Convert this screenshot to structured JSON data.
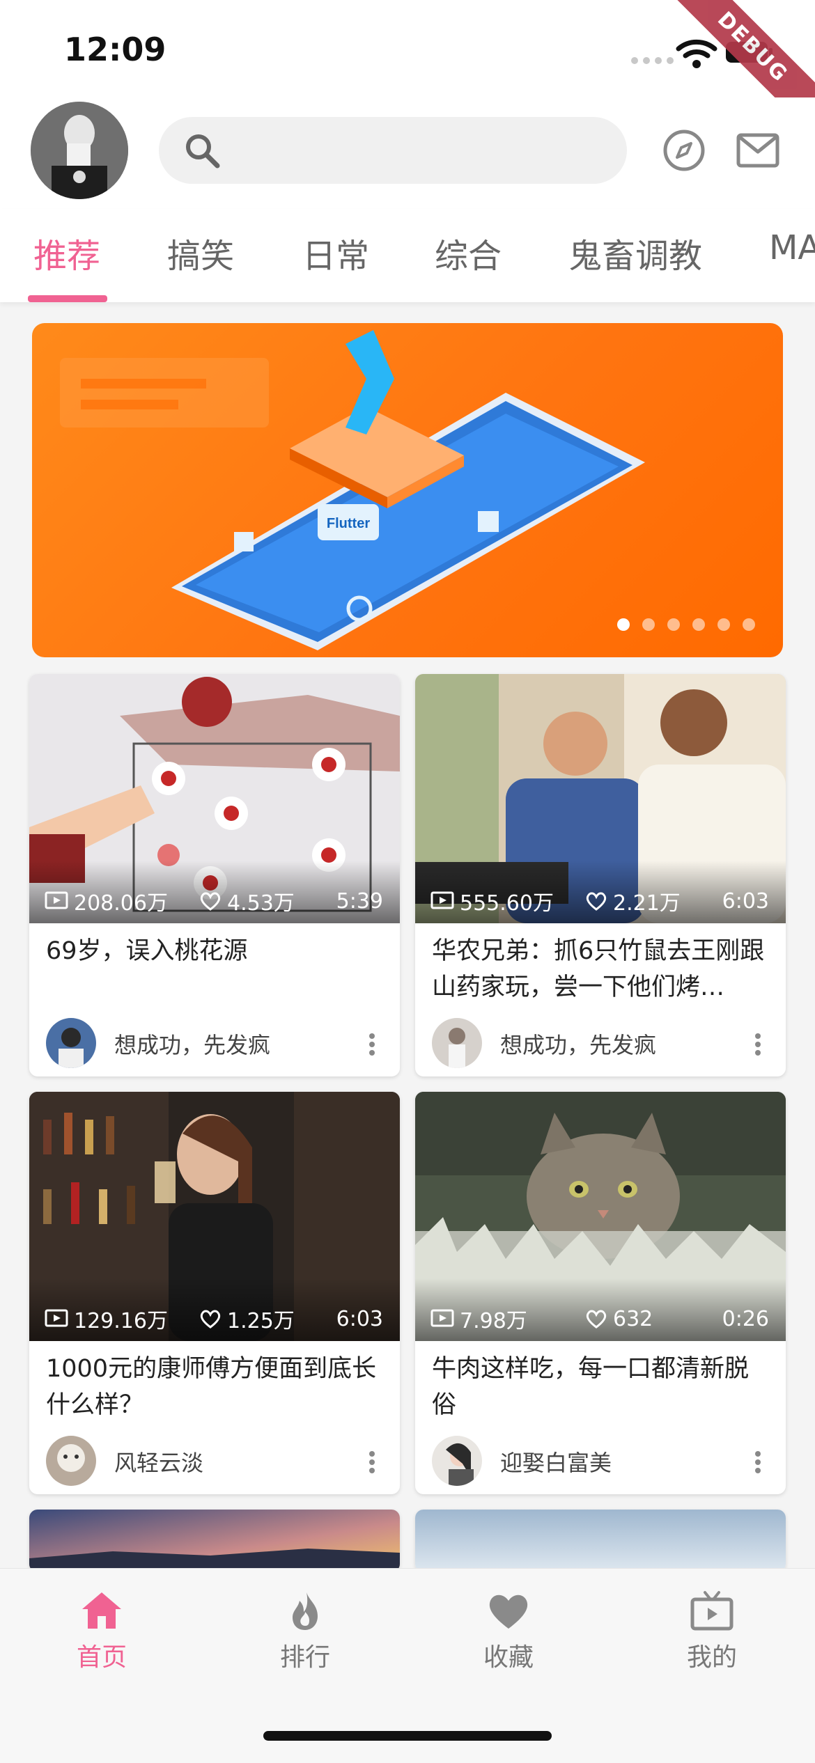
{
  "status": {
    "time": "12:09",
    "debug_label": "DEBUG"
  },
  "header": {
    "search_placeholder": "",
    "icons": [
      "search-icon",
      "compass-icon",
      "mail-icon"
    ]
  },
  "tabs": [
    "推荐",
    "搞笑",
    "日常",
    "综合",
    "鬼畜调教",
    "MA"
  ],
  "active_tab": "推荐",
  "banner": {
    "image_text": "Flutter",
    "page_count": 6,
    "current_page": 1
  },
  "videos": [
    {
      "views": "208.06万",
      "likes": "4.53万",
      "duration": "5:39",
      "title": "69岁，误入桃花源",
      "author": "想成功，先发疯"
    },
    {
      "views": "555.60万",
      "likes": "2.21万",
      "duration": "6:03",
      "title": "华农兄弟：抓6只竹鼠去王刚跟山药家玩，尝一下他们烤…",
      "author": "想成功，先发疯"
    },
    {
      "views": "129.16万",
      "likes": "1.25万",
      "duration": "6:03",
      "title": "1000元的康师傅方便面到底长什么样？",
      "author": "风轻云淡"
    },
    {
      "views": "7.98万",
      "likes": "632",
      "duration": "0:26",
      "title": "牛肉这样吃，每一口都清新脱俗",
      "author": "迎娶白富美"
    }
  ],
  "bottom_nav": [
    {
      "label": "首页",
      "icon": "home-icon",
      "active": true
    },
    {
      "label": "排行",
      "icon": "fire-icon",
      "active": false
    },
    {
      "label": "收藏",
      "icon": "heart-icon",
      "active": false
    },
    {
      "label": "我的",
      "icon": "tv-icon",
      "active": false
    }
  ],
  "colors": {
    "accent": "#f06292",
    "banner": "#ff7410",
    "text": "#222222",
    "muted": "#777777"
  }
}
